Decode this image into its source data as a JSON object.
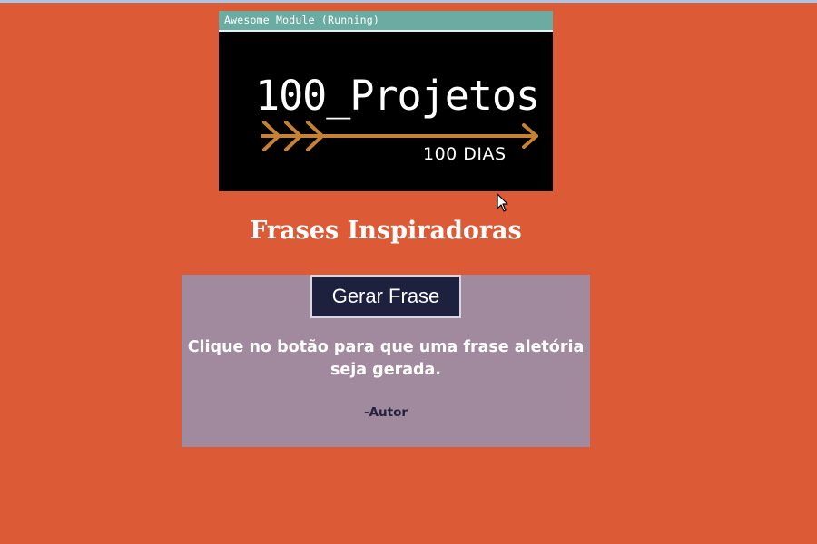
{
  "module": {
    "window_title": "Awesome Module (Running)",
    "logo_title": "100_Projetos",
    "logo_subtitle": "100 DIAS",
    "arrow_icon": "arrow-icon"
  },
  "main": {
    "title": "Frases Inspiradoras",
    "button_label": "Gerar Frase",
    "quote": "Clique no botão para que uma frase aletória seja gerada.",
    "author": "-Autor"
  },
  "colors": {
    "background": "#dc5a36",
    "titlebar": "#6aaba2",
    "card": "#a18a9e",
    "button": "#1d213e",
    "arrow": "#c68234"
  }
}
